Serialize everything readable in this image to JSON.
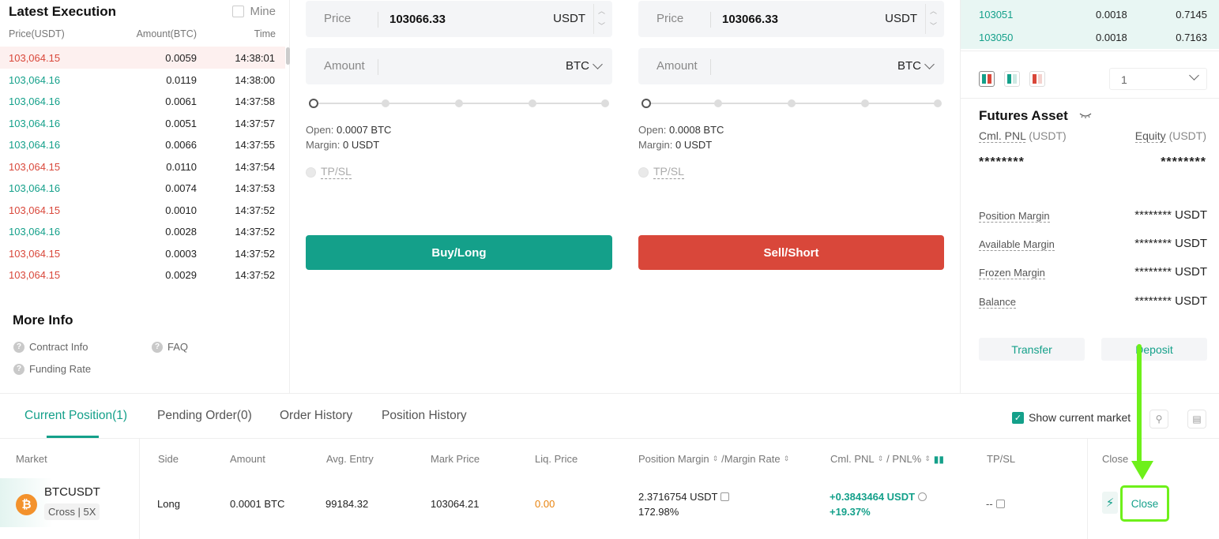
{
  "latest_execution": {
    "title": "Latest Execution",
    "mine_label": "Mine",
    "headers": {
      "price": "Price(USDT)",
      "amount": "Amount(BTC)",
      "time": "Time"
    },
    "trades": [
      {
        "price": "103,064.15",
        "amount": "0.0059",
        "time": "14:38:01",
        "side": "down"
      },
      {
        "price": "103,064.16",
        "amount": "0.0119",
        "time": "14:38:00",
        "side": "up"
      },
      {
        "price": "103,064.16",
        "amount": "0.0061",
        "time": "14:37:58",
        "side": "up"
      },
      {
        "price": "103,064.16",
        "amount": "0.0051",
        "time": "14:37:57",
        "side": "up"
      },
      {
        "price": "103,064.16",
        "amount": "0.0066",
        "time": "14:37:55",
        "side": "up"
      },
      {
        "price": "103,064.15",
        "amount": "0.0110",
        "time": "14:37:54",
        "side": "down"
      },
      {
        "price": "103,064.16",
        "amount": "0.0074",
        "time": "14:37:53",
        "side": "up"
      },
      {
        "price": "103,064.15",
        "amount": "0.0010",
        "time": "14:37:52",
        "side": "down"
      },
      {
        "price": "103,064.16",
        "amount": "0.0028",
        "time": "14:37:52",
        "side": "up"
      },
      {
        "price": "103,064.15",
        "amount": "0.0003",
        "time": "14:37:52",
        "side": "down"
      },
      {
        "price": "103,064.15",
        "amount": "0.0029",
        "time": "14:37:52",
        "side": "down"
      }
    ]
  },
  "more_info": {
    "title": "More Info",
    "contract_info": "Contract Info",
    "faq": "FAQ",
    "funding_rate": "Funding Rate"
  },
  "buy_form": {
    "price_label": "Price",
    "price_value": "103066.33",
    "price_unit": "USDT",
    "amount_label": "Amount",
    "amount_unit": "BTC",
    "open_label": "Open:",
    "open_value": "0.0007 BTC",
    "margin_label": "Margin:",
    "margin_value": "0 USDT",
    "tpsl_label": "TP/SL",
    "button_label": "Buy/Long"
  },
  "sell_form": {
    "price_label": "Price",
    "price_value": "103066.33",
    "price_unit": "USDT",
    "amount_label": "Amount",
    "amount_unit": "BTC",
    "open_label": "Open:",
    "open_value": "0.0008 BTC",
    "margin_label": "Margin:",
    "margin_value": "0 USDT",
    "tpsl_label": "TP/SL",
    "button_label": "Sell/Short"
  },
  "order_book": {
    "rows": [
      {
        "price": "103051",
        "amount": "0.0018",
        "total": "0.7145"
      },
      {
        "price": "103050",
        "amount": "0.0018",
        "total": "0.7163"
      }
    ],
    "depth_value": "1"
  },
  "futures_asset": {
    "title": "Futures Asset",
    "cml_pnl_label": "Cml. PNL",
    "cml_pnl_unit": "(USDT)",
    "equity_label": "Equity",
    "equity_unit": "(USDT)",
    "cml_pnl_value": "********",
    "equity_value": "********",
    "position_margin_label": "Position Margin",
    "position_margin_value": "******** USDT",
    "available_margin_label": "Available Margin",
    "available_margin_value": "******** USDT",
    "frozen_margin_label": "Frozen Margin",
    "frozen_margin_value": "******** USDT",
    "balance_label": "Balance",
    "balance_value": "******** USDT",
    "transfer_label": "Transfer",
    "deposit_label": "Deposit"
  },
  "positions": {
    "tabs": [
      "Current Position(1)",
      "Pending Order(0)",
      "Order History",
      "Position History"
    ],
    "show_current_market": "Show current market",
    "headers": {
      "market": "Market",
      "side": "Side",
      "amount": "Amount",
      "avg_entry": "Avg. Entry",
      "mark_price": "Mark Price",
      "liq_price": "Liq. Price",
      "position_margin": "Position Margin",
      "margin_rate": "/Margin Rate",
      "cml_pnl": "Cml. PNL",
      "pnl_pct": "/ PNL%",
      "tpsl": "TP/SL",
      "close": "Close"
    },
    "row": {
      "symbol": "BTCUSDT",
      "leverage": "Cross | 5X",
      "coin_glyph": "₿",
      "side": "Long",
      "amount": "0.0001 BTC",
      "avg_entry": "99184.32",
      "mark_price": "103064.21",
      "liq_price": "0.00",
      "position_margin": "2.3716754 USDT",
      "margin_rate": "172.98%",
      "cml_pnl": "+0.3843464 USDT",
      "pnl_pct": "+19.37%",
      "tpsl": "--",
      "close_label": "Close"
    }
  },
  "colors": {
    "green": "#14a08a",
    "red": "#d9473a",
    "annotation": "#6ef01a",
    "liq_orange": "#e8830e"
  },
  "icons": [
    "question-icon",
    "eye-closed-icon",
    "chevron-down-icon",
    "edit-icon",
    "bolt-icon",
    "filter-icon",
    "document-icon",
    "bar-chart-icon",
    "bitcoin-icon"
  ]
}
